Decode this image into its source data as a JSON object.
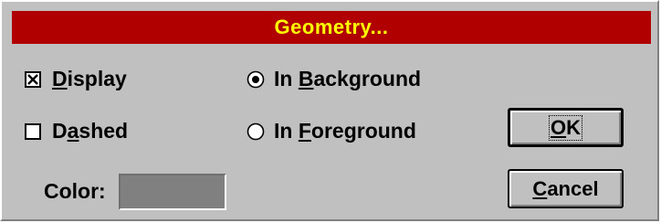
{
  "dialog": {
    "title": "Geometry...",
    "display": {
      "label_u": "D",
      "label_rest": "isplay",
      "checked": true
    },
    "dashed": {
      "label_pre": "D",
      "label_u": "a",
      "label_rest": "shed",
      "checked": false
    },
    "in_background": {
      "label_pre": "In ",
      "label_u": "B",
      "label_rest": "ackground",
      "selected": true
    },
    "in_foreground": {
      "label_pre": "In ",
      "label_u": "F",
      "label_rest": "oreground",
      "selected": false
    },
    "color_label": "Color:",
    "color_value": "#808080",
    "ok_label_u": "O",
    "ok_label_rest": "K",
    "cancel_label_u": "C",
    "cancel_label_rest": "ancel"
  },
  "colors": {
    "title_bg": "#b00000",
    "title_fg": "#ffff00",
    "face": "#c0c0c0"
  }
}
